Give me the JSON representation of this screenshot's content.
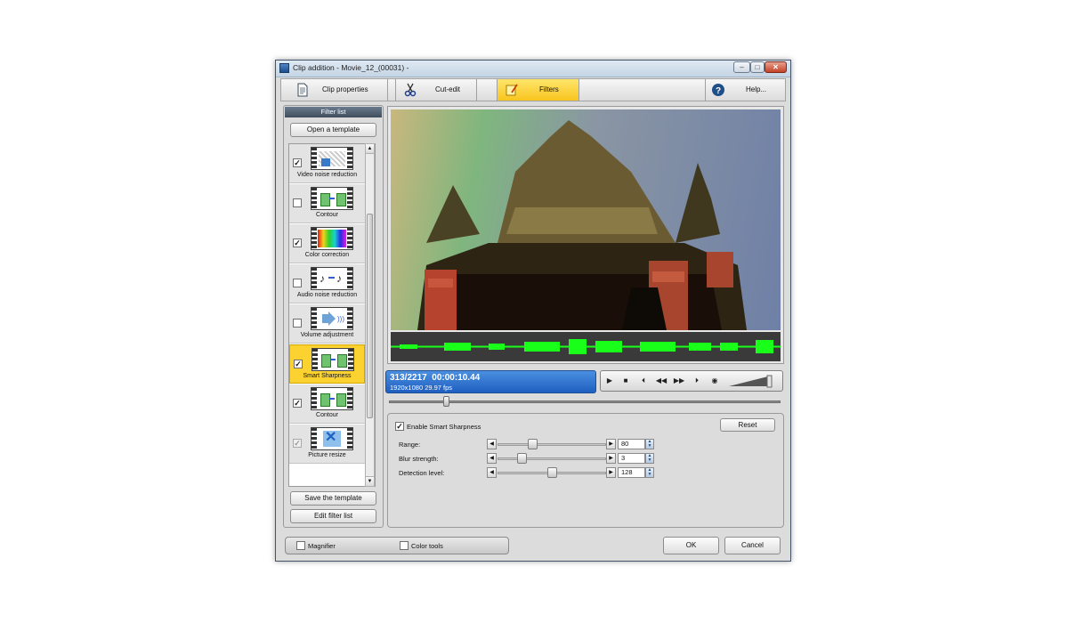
{
  "window": {
    "title": "Clip addition - Movie_12_(00031) -",
    "controls": {
      "minimize": "–",
      "maximize": "□",
      "close": "✕"
    }
  },
  "tabs": [
    {
      "label": "Clip properties",
      "icon": "document-icon"
    },
    {
      "label": "Cut-edit",
      "icon": "scissors-icon"
    },
    {
      "label": "Filters",
      "icon": "filters-icon",
      "active": true
    },
    {
      "label": "Help...",
      "icon": "help-icon"
    }
  ],
  "sidebar": {
    "title": "Filter list",
    "open_template": "Open a template",
    "save_template": "Save the template",
    "edit_filter_list": "Edit filter list",
    "filters": [
      {
        "label": "Video noise reduction",
        "checked": true,
        "icon": "noise-reduction-icon"
      },
      {
        "label": "Contour",
        "checked": false,
        "icon": "contour-icon"
      },
      {
        "label": "Color correction",
        "checked": true,
        "icon": "color-correction-icon"
      },
      {
        "label": "Audio noise reduction",
        "checked": false,
        "icon": "audio-noise-icon"
      },
      {
        "label": "Volume adjustment",
        "checked": false,
        "icon": "volume-icon"
      },
      {
        "label": "Smart Sharpness",
        "checked": true,
        "selected": true,
        "icon": "sharpness-icon"
      },
      {
        "label": "Contour",
        "checked": true,
        "icon": "contour-icon"
      },
      {
        "label": "Picture resize",
        "checked": true,
        "disabled": true,
        "icon": "resize-icon"
      }
    ]
  },
  "player": {
    "frame": "313/2217",
    "time": "00:00:10.44",
    "format": "1920x1080 29.97  fps",
    "position": 0.1412
  },
  "settings": {
    "enable_label": "Enable Smart Sharpness",
    "reset_label": "Reset",
    "params": [
      {
        "label": "Range:",
        "value": "80",
        "level": 0.31
      },
      {
        "label": "Blur strength:",
        "value": "3",
        "level": 0.2
      },
      {
        "label": "Detection level:",
        "value": "128",
        "level": 0.5
      }
    ]
  },
  "bottom": {
    "magnifier": "Magnifier",
    "color_tools": "Color tools",
    "ok": "OK",
    "cancel": "Cancel"
  }
}
